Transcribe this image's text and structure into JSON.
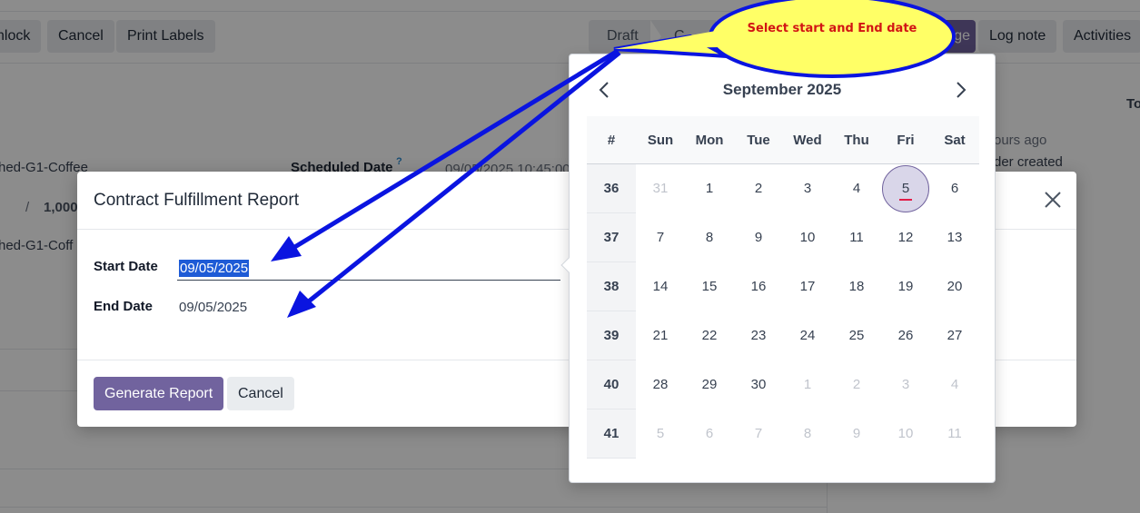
{
  "background": {
    "toolbar_buttons": [
      "nlock",
      "Cancel",
      "Print Labels"
    ],
    "status_steps": [
      "Draft",
      "C"
    ],
    "right_buttons": [
      "ge",
      "Log note",
      "Activities"
    ],
    "fragments": [
      "hed-G1-Coffee",
      "/",
      "1,000",
      "hed-G1-Coff",
      "Scheduled Date",
      "?",
      "09/05/2025 10:45:00",
      "To",
      "ours ago",
      "der created"
    ]
  },
  "modal": {
    "title": "Contract Fulfillment Report",
    "start_label": "Start Date",
    "start_value": "09/05/2025",
    "end_label": "End Date",
    "end_value": "09/05/2025",
    "generate_label": "Generate Report",
    "cancel_label": "Cancel"
  },
  "datepicker": {
    "month_label": "September 2025",
    "headers": [
      "#",
      "Sun",
      "Mon",
      "Tue",
      "Wed",
      "Thu",
      "Fri",
      "Sat"
    ],
    "weeks": [
      {
        "num": "36",
        "days": [
          "31",
          "1",
          "2",
          "3",
          "4",
          "5",
          "6"
        ],
        "muted": [
          true,
          false,
          false,
          false,
          false,
          false,
          false
        ]
      },
      {
        "num": "37",
        "days": [
          "7",
          "8",
          "9",
          "10",
          "11",
          "12",
          "13"
        ],
        "muted": [
          false,
          false,
          false,
          false,
          false,
          false,
          false
        ]
      },
      {
        "num": "38",
        "days": [
          "14",
          "15",
          "16",
          "17",
          "18",
          "19",
          "20"
        ],
        "muted": [
          false,
          false,
          false,
          false,
          false,
          false,
          false
        ]
      },
      {
        "num": "39",
        "days": [
          "21",
          "22",
          "23",
          "24",
          "25",
          "26",
          "27"
        ],
        "muted": [
          false,
          false,
          false,
          false,
          false,
          false,
          false
        ]
      },
      {
        "num": "40",
        "days": [
          "28",
          "29",
          "30",
          "1",
          "2",
          "3",
          "4"
        ],
        "muted": [
          false,
          false,
          false,
          true,
          true,
          true,
          true
        ]
      },
      {
        "num": "41",
        "days": [
          "5",
          "6",
          "7",
          "8",
          "9",
          "10",
          "11"
        ],
        "muted": [
          true,
          true,
          true,
          true,
          true,
          true,
          true
        ]
      }
    ],
    "selected_day": "5"
  },
  "annotation": {
    "callout_text": "Select start and End date",
    "bubble_fill": "#ffff66",
    "outline_color": "#0a14e0"
  },
  "colors": {
    "primary": "#71639e",
    "selection": "#1e5bd6"
  }
}
